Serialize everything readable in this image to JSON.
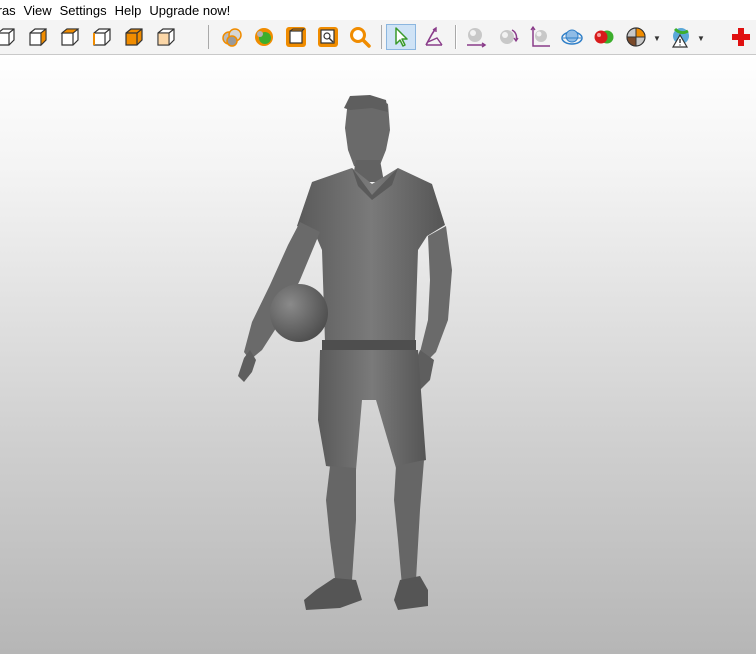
{
  "menubar": {
    "items": [
      {
        "label": "tras"
      },
      {
        "label": "View"
      },
      {
        "label": "Settings"
      },
      {
        "label": "Help"
      },
      {
        "label": "Upgrade now!"
      }
    ]
  },
  "toolbar": {
    "view_buttons": [
      {
        "icon": "front-view-cube-icon"
      },
      {
        "icon": "back-view-cube-icon"
      },
      {
        "icon": "left-view-cube-icon"
      },
      {
        "icon": "right-view-cube-icon"
      },
      {
        "icon": "top-view-cube-icon"
      },
      {
        "icon": "bottom-view-cube-icon"
      }
    ],
    "colors": {
      "accent_orange": "#f08c00",
      "active_tool_bg": "#cfe3f6",
      "add_icon_red": "#e01010",
      "sphere_red": "#d81b1b",
      "sphere_green": "#3cae2c",
      "pointer_green": "#3a9a2a",
      "transform_purple": "#8a3c8a"
    }
  },
  "viewport": {
    "model": "standing man in polo shirt and shorts holding a ball",
    "model_color": "#6f6f6f"
  }
}
